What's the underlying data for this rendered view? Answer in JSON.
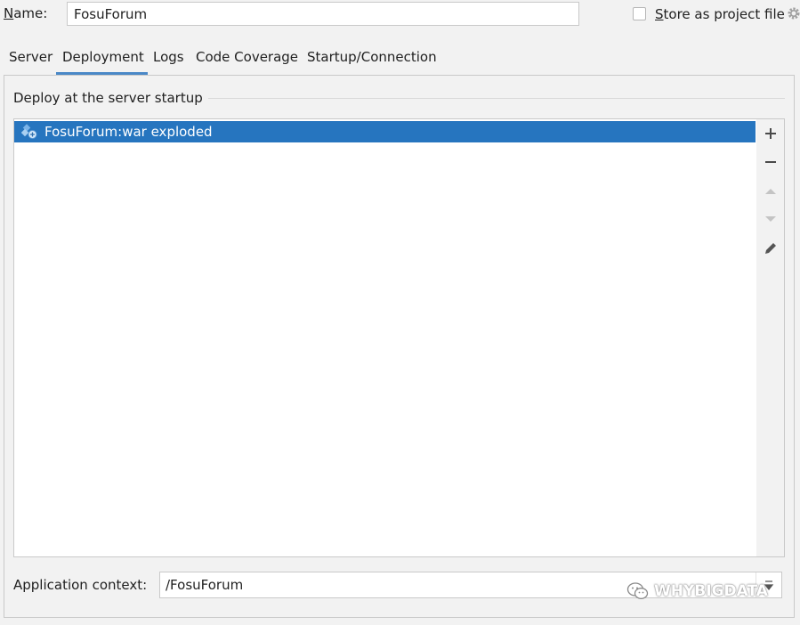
{
  "name_row": {
    "label": "Name:",
    "value": "FosuForum",
    "store_label": "Store as project file"
  },
  "tabs": [
    {
      "label": "Server"
    },
    {
      "label": "Deployment"
    },
    {
      "label": "Logs"
    },
    {
      "label": "Code Coverage"
    },
    {
      "label": "Startup/Connection"
    }
  ],
  "active_tab": "Deployment",
  "deploy": {
    "section_title": "Deploy at the server startup",
    "items": [
      {
        "label": "FosuForum:war exploded",
        "icon": "artifact-icon",
        "selected": true
      }
    ],
    "toolbar_icons": [
      "add-icon",
      "remove-icon",
      "move-up-icon",
      "move-down-icon",
      "edit-icon"
    ]
  },
  "app_context": {
    "label": "Application context:",
    "value": "/FosuForum"
  },
  "watermark": {
    "text": "WHYBIGDATA",
    "icon": "wechat-icon"
  },
  "colors": {
    "selection": "#2675bf",
    "tab_underline": "#4a88c7",
    "background": "#f2f2f2"
  }
}
